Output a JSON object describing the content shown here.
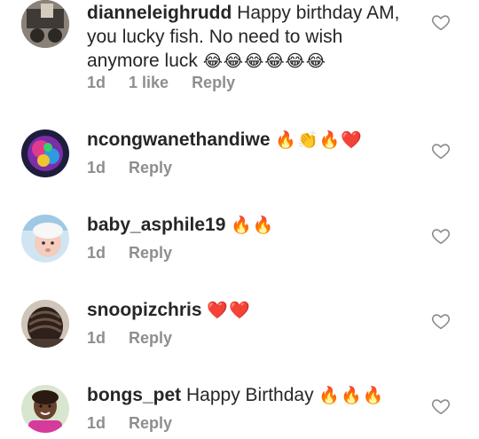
{
  "comments": [
    {
      "username": "dianneleighrudd",
      "text": " Happy birthday AM, you lucky fish. No need to wish anymore luck ",
      "emoji": "😂😂😂😂😂😂",
      "time": "1d",
      "likes": "1 like",
      "reply": "Reply",
      "avatar_colors": [
        "#5a5148",
        "#b9b0a4"
      ]
    },
    {
      "username": "ncongwanethandiwe",
      "text": " ",
      "emoji": "🔥👏🔥❤️",
      "time": "1d",
      "reply": "Reply",
      "avatar_colors": [
        "#1a1a3a",
        "#d63aa8"
      ]
    },
    {
      "username": "baby_asphile19",
      "text": " ",
      "emoji": "🔥🔥",
      "time": "1d",
      "reply": "Reply",
      "avatar_colors": [
        "#cfe6f2",
        "#f3c8b8"
      ]
    },
    {
      "username": "snoopizchris",
      "text": " ",
      "emoji": "❤️❤️",
      "time": "1d",
      "reply": "Reply",
      "avatar_colors": [
        "#3a2a22",
        "#a38d7a"
      ]
    },
    {
      "username": "bongs_pet",
      "text": " Happy Birthday ",
      "emoji": "🔥🔥🔥",
      "time": "1d",
      "reply": "Reply",
      "avatar_colors": [
        "#2a1a12",
        "#d63a9a"
      ]
    }
  ]
}
